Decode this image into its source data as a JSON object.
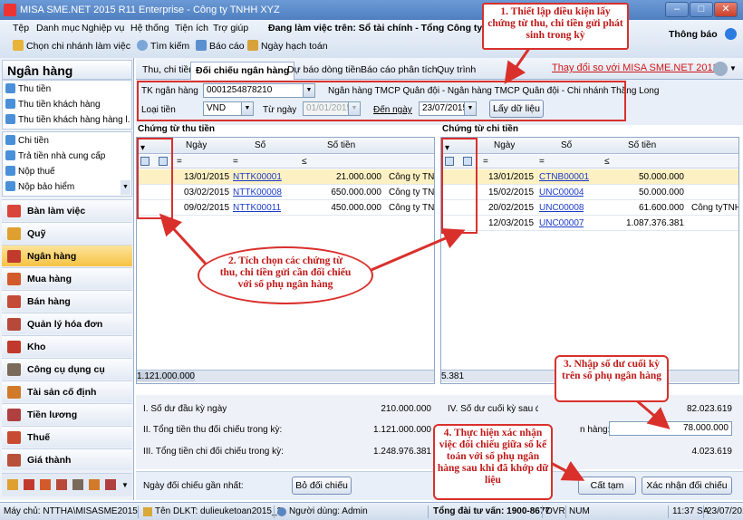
{
  "window": {
    "title": "MISA SME.NET 2015 R11 Enterprise - Công ty TNHH XYZ",
    "working_on": "Đang làm việc trên: Sổ tài chính - Tổng Công ty XYZ",
    "notifications": "Thông báo"
  },
  "menu": [
    "Tệp",
    "Danh mục",
    "Nghiệp vụ",
    "Hệ thống",
    "Tiện ích",
    "Trợ giúp"
  ],
  "toolbar": {
    "select_branch": "Chọn chi nhánh làm việc",
    "search": "Tìm kiếm",
    "report": "Báo cáo",
    "accounting_date": "Ngày hạch toán"
  },
  "sidebar": {
    "header": "Ngân hàng",
    "group1": [
      "Thu tiền",
      "Thu tiền khách hàng",
      "Thu tiền khách hàng hàng l..."
    ],
    "group2": [
      "Chi tiền",
      "Trả tiền nhà cung cấp",
      "Nộp thuế",
      "Nộp bảo hiểm"
    ],
    "modules": [
      "Bàn làm việc",
      "Quỹ",
      "Ngân hàng",
      "Mua hàng",
      "Bán hàng",
      "Quản lý hóa đơn",
      "Kho",
      "Công cụ dụng cụ",
      "Tài sản cố định",
      "Tiền lương",
      "Thuế",
      "Giá thành"
    ],
    "active_module": "Ngân hàng"
  },
  "tabs": [
    "Thu, chi tiền",
    "Đối chiếu ngân hàng",
    "Dự báo dòng tiền",
    "Báo cáo phân tích",
    "Quy trình"
  ],
  "active_tab": "Đối chiếu ngân hàng",
  "compare_link": "Thay đổi so với MISA SME.NET 2012",
  "filter": {
    "account_label": "TK ngân hàng",
    "account_value": "0001254878210",
    "bank_name": "Ngân hàng TMCP Quân đội - Ngân hàng TMCP Quân đội - Chi nhánh Thăng Long",
    "currency_label": "Loại tiền",
    "currency_value": "VND",
    "from_label": "Từ ngày",
    "from_value": "01/01/2015",
    "to_label": "Đến ngày",
    "to_value": "23/07/2015",
    "get_data_button": "Lấy dữ liệu"
  },
  "receipts": {
    "title": "Chứng từ thu tiền",
    "columns": [
      "Ngày",
      "Số",
      "Số tiền"
    ],
    "filter_ops": [
      "=",
      "=",
      "≤"
    ],
    "rows": [
      {
        "checked": true,
        "date": "13/01/2015",
        "no": "NTTK00001",
        "amount": "21.000.000",
        "desc": "Công ty TNHH"
      },
      {
        "checked": true,
        "date": "03/02/2015",
        "no": "NTTK00008",
        "amount": "650.000.000",
        "desc": "Công ty TNHH"
      },
      {
        "checked": true,
        "date": "09/02/2015",
        "no": "NTTK00011",
        "amount": "450.000.000",
        "desc": "Công ty TNHH"
      }
    ],
    "total": "1.121.000.000"
  },
  "payments": {
    "title": "Chứng từ chi tiền",
    "columns": [
      "Ngày",
      "Số",
      "Số tiền"
    ],
    "filter_ops": [
      "=",
      "=",
      "≤"
    ],
    "rows": [
      {
        "checked": true,
        "date": "13/01/2015",
        "no": "CTNB00001",
        "amount": "50.000.000",
        "desc": ""
      },
      {
        "checked": true,
        "date": "15/02/2015",
        "no": "UNC00004",
        "amount": "50.000.000",
        "desc": ""
      },
      {
        "checked": true,
        "date": "20/02/2015",
        "no": "UNC00008",
        "amount": "61.600.000",
        "desc": "Công tyTNHH"
      },
      {
        "checked": true,
        "date": "12/03/2015",
        "no": "UNC00007",
        "amount": "1.087.376.381",
        "desc": ""
      }
    ],
    "total_partial": "5.381"
  },
  "summary": {
    "opening_label": "I. Số dư đầu kỳ ngày",
    "opening_value": "210.000.000",
    "receipts_label": "II. Tổng tiền thu đối chiếu trong kỳ:",
    "receipts_value": "1.121.000.000",
    "payments_label": "III. Tổng tiền chi đối chiếu trong kỳ:",
    "payments_value": "1.248.976.381",
    "closing_label": "IV. Số dư cuối kỳ sau đối chiếu (",
    "closing_value": "82.023.619",
    "bank_label": "n hàng:",
    "bank_value": "78.000.000",
    "diff_value": "4.023.619"
  },
  "actions": {
    "last_date_label": "Ngày đối chiếu gần nhất:",
    "undo_button": "Bỏ đối chiếu",
    "save_button": "Cất tạm",
    "confirm_button": "Xác nhận đối chiếu"
  },
  "status": {
    "server": "Máy chủ: NTTHA\\MISASME2015",
    "db": "Tên DLKT: dulieuketoan2015_2",
    "user": "Người dùng: Admin",
    "hotline": "Tổng đài tư vấn: 1900-8677",
    "ovr": "OVR",
    "num": "NUM",
    "time": "11:37 SA",
    "date": "23/07/2015"
  },
  "callouts": {
    "c1": "1. Thiết lập điều kiện lấy chứng từ thu, chi tiền gửi phát sinh trong kỳ",
    "c2": "2. Tích chọn các chứng từ thu, chi tiền gửi cần đối chiếu với sổ phụ ngân hàng",
    "c3": "3. Nhập số dư cuối kỳ trên sổ phụ ngân hàng",
    "c4": "4. Thực hiện xác nhận việc đối chiếu giữa sổ kế toán với sổ phụ ngân hàng sau khi đã khớp dữ liệu"
  }
}
